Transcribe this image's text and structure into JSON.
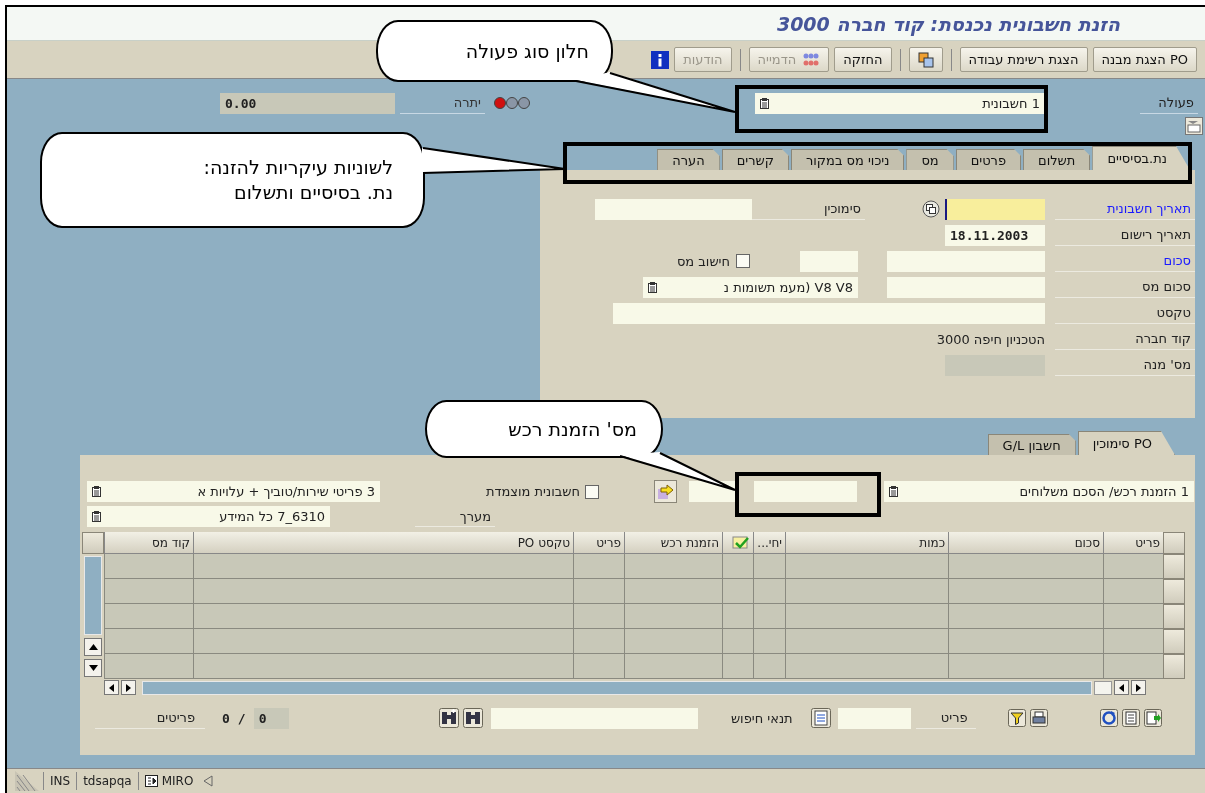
{
  "window": {
    "title": "הזנת חשבונית נכנסת: קוד חברה 3000"
  },
  "toolbar": [
    {
      "kind": "text",
      "label": "PO הצגת מבנה",
      "disabled": false
    },
    {
      "kind": "text",
      "label": "הצגת רשימת עבודה",
      "disabled": false
    },
    {
      "kind": "separator"
    },
    {
      "kind": "windows",
      "disabled": false
    },
    {
      "kind": "separator"
    },
    {
      "kind": "text",
      "label": "החזקה",
      "disabled": false
    },
    {
      "kind": "simulate",
      "label": "הדמייה",
      "disabled": true
    },
    {
      "kind": "separator"
    },
    {
      "kind": "text",
      "label": "הודעות",
      "disabled": true
    },
    {
      "kind": "info",
      "disabled": false
    }
  ],
  "header": {
    "action": {
      "label": "פעולה",
      "value": "1 חשבונית"
    },
    "balance": {
      "label": "יתרה",
      "value": "0.00",
      "lights": [
        {
          "on": true
        },
        {
          "on": false
        },
        {
          "on": false
        }
      ]
    }
  },
  "tabs": [
    {
      "label": "נת.בסיסיים",
      "selected": true
    },
    {
      "label": "תשלום",
      "selected": false
    },
    {
      "label": "פרטים",
      "selected": false
    },
    {
      "label": "מס",
      "selected": false
    },
    {
      "label": "ניכוי מס במקור",
      "selected": false
    },
    {
      "label": "קשרים",
      "selected": false
    },
    {
      "label": "הערה",
      "selected": false
    }
  ],
  "basic_data": {
    "invoice_date": {
      "label": "תאריך חשבונית",
      "required": true,
      "focused": true
    },
    "reference": {
      "label": "סימוכין",
      "required": false
    },
    "posting_date": {
      "label": "תאריך רישום",
      "required": false,
      "value": "18.11.2003"
    },
    "amount": {
      "label": "סכום",
      "required": true
    },
    "calculate_tax": {
      "label": "חישוב מס",
      "checked": false
    },
    "tax_amount": {
      "label": "סכום מס",
      "required": false
    },
    "tax_code": {
      "value": "V8 V8 (מעמ תשומות נ"
    },
    "text": {
      "label": "טקסט",
      "required": false
    },
    "company_code": {
      "label": "קוד חברה",
      "required": false,
      "value": "3000 הטכניון חיפה"
    },
    "batch_number": {
      "label": "מס' מנה",
      "required": false,
      "disabled": true
    }
  },
  "item_tabs": [
    {
      "label": "PO סימוכין",
      "selected": true
    },
    {
      "label": "חשבון G/L",
      "selected": false
    }
  ],
  "po_reference": {
    "document_type": "1 הזמנת רכש/ הסכם משלוחים",
    "matched_invoice": {
      "label": "חשבונית מוצמדת",
      "checked": false
    },
    "item_selection": "3 פריטי שירות/טוביך + עלויות א",
    "layout": {
      "label": "מערך",
      "value": "6310_7 כל המידע"
    }
  },
  "table": {
    "columns": [
      {
        "kind": "text",
        "label": "פריט"
      },
      {
        "kind": "text",
        "label": "סכום"
      },
      {
        "kind": "text",
        "label": "כמות"
      },
      {
        "kind": "text",
        "label": "יחי..."
      },
      {
        "kind": "check"
      },
      {
        "kind": "text",
        "label": "הזמנת רכש"
      },
      {
        "kind": "text",
        "label": "פריט"
      },
      {
        "kind": "text",
        "label": "טקסט PO"
      },
      {
        "kind": "text",
        "label": "קוד מס"
      }
    ]
  },
  "footer": {
    "item_label": "פריט",
    "search_label": "תנאי חיפוש",
    "total": "0",
    "separator": "/",
    "current": "0",
    "items_label": "פריטים"
  },
  "status_bar": [
    {
      "kind": "transaction",
      "label": "MIRO"
    },
    {
      "kind": "text",
      "label": "tdsapqa"
    },
    {
      "kind": "text",
      "label": "INS"
    }
  ],
  "callouts": [
    {
      "lines": [
        "חלון סוג פעולה"
      ]
    },
    {
      "lines": [
        "לשוניות עיקריות להזנה:",
        "נת. בסיסיים ותשלום"
      ]
    },
    {
      "lines": [
        "מס' הזמנת רכש"
      ]
    }
  ]
}
